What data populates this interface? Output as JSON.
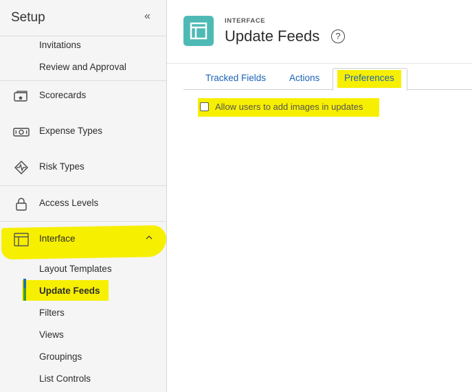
{
  "sidebar": {
    "title": "Setup",
    "collapse_glyph": "«",
    "top_subitems": [
      "Invitations",
      "Review and Approval"
    ],
    "items": [
      {
        "label": "Scorecards",
        "icon": "scorecard-icon"
      },
      {
        "label": "Expense Types",
        "icon": "money-icon"
      },
      {
        "label": "Risk Types",
        "icon": "risk-icon"
      },
      {
        "label": "Access Levels",
        "icon": "lock-icon"
      },
      {
        "label": "Interface",
        "icon": "layout-icon",
        "expanded": true,
        "chevron_glyph": "^"
      }
    ],
    "interface_children": [
      "Layout Templates",
      "Update Feeds",
      "Filters",
      "Views",
      "Groupings",
      "List Controls"
    ],
    "active_child": "Update Feeds"
  },
  "header": {
    "kicker": "INTERFACE",
    "title": "Update Feeds",
    "help_glyph": "?",
    "icon": "layout-icon"
  },
  "tabs": [
    "Tracked Fields",
    "Actions",
    "Preferences"
  ],
  "active_tab": "Preferences",
  "preferences": {
    "checkbox_label": "Allow users to add images in updates",
    "checked": false
  },
  "colors": {
    "highlight": "#f7ef00",
    "teal": "#4fbab5",
    "link_blue": "#1a63b8",
    "active_blue": "#1f6fbf",
    "active_green": "#3c9a3c"
  }
}
